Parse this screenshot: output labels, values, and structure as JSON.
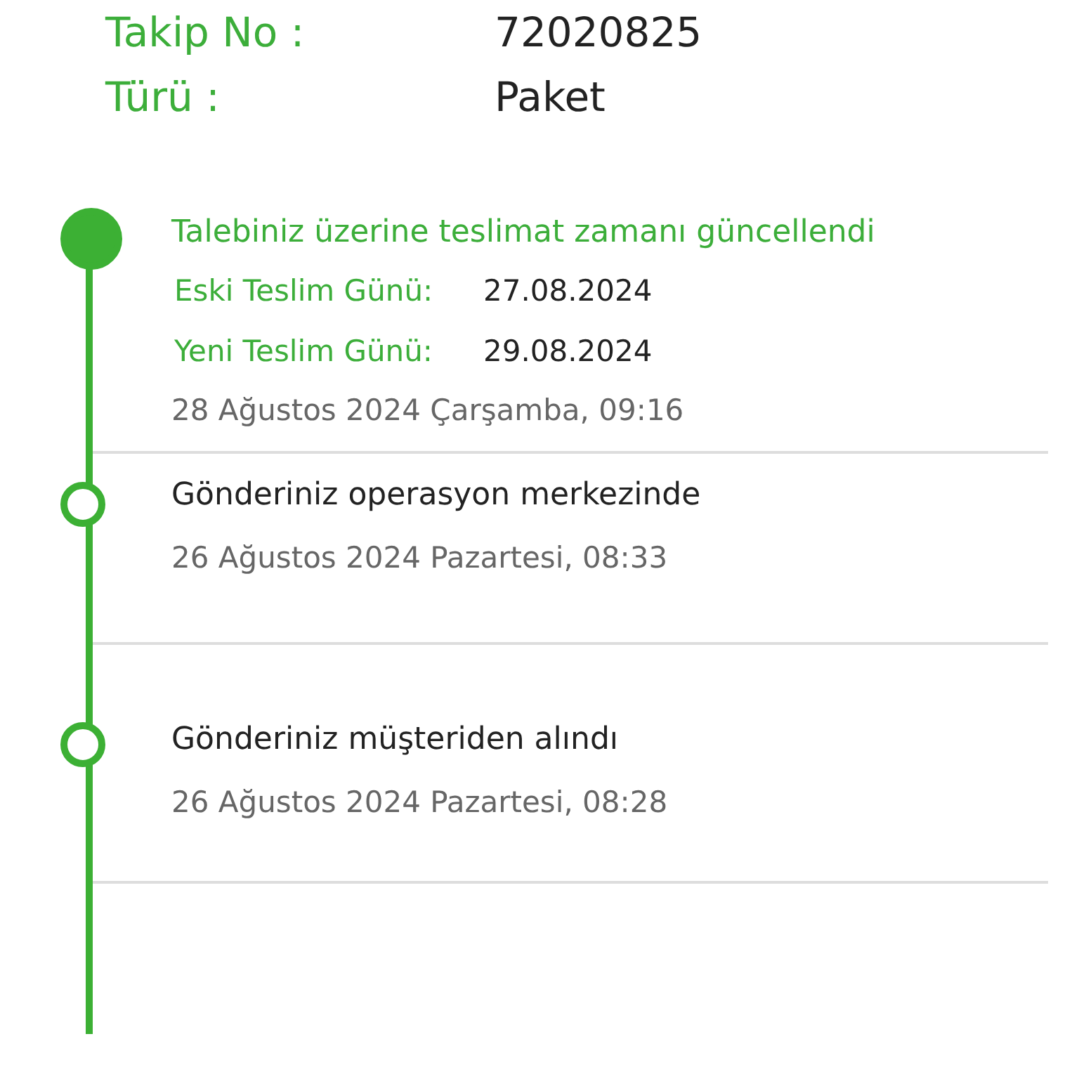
{
  "info": [
    {
      "label": "Takip No :",
      "value": "72020825"
    },
    {
      "label": "Türü :",
      "value": "Paket"
    }
  ],
  "events": [
    {
      "title": "Talebiniz üzerine teslimat zamanı güncellendi",
      "current": true,
      "details": [
        {
          "label": "Eski Teslim Günü:",
          "value": "27.08.2024"
        },
        {
          "label": "Yeni Teslim Günü:",
          "value": "29.08.2024"
        }
      ],
      "date": "28 Ağustos 2024 Çarşamba, 09:16"
    },
    {
      "title": "Gönderiniz operasyon merkezinde",
      "current": false,
      "date": "26 Ağustos 2024 Pazartesi, 08:33"
    },
    {
      "title": "Gönderiniz müşteriden alındı",
      "current": false,
      "date": "26 Ağustos 2024 Pazartesi, 08:28"
    }
  ]
}
